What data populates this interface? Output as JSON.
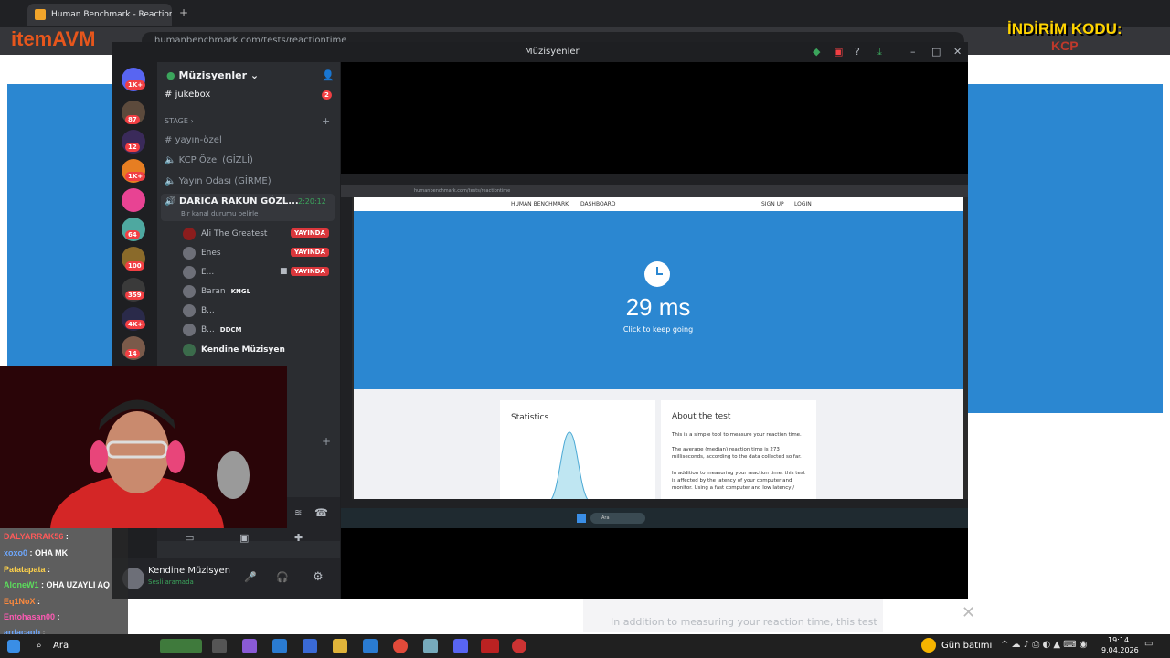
{
  "browser": {
    "tab_title": "Human Benchmark - Reaction Ti",
    "url": "humanbenchmark.com/tests/reactiontime"
  },
  "overlay": {
    "logo": "itemAVM",
    "promo": "İNDİRİM KODU:",
    "promo_code": "KCP"
  },
  "background_page": {
    "stats_text": "In addition to measuring your reaction time, this test"
  },
  "discord": {
    "window_title": "Müzisyenler",
    "server_name": "Müzisyenler",
    "guild_badges": [
      "1K+",
      "87",
      "12",
      "1K+",
      "",
      "64",
      "100",
      "359",
      "4K+",
      "14"
    ],
    "channels": [
      {
        "name": "jukebox",
        "badge": "2"
      },
      {
        "name": "STAGE"
      },
      {
        "name": "yayın-özel"
      },
      {
        "name": "KCP Özel (GİZLİ)"
      },
      {
        "name": "Yayın Odası (GİRME)"
      }
    ],
    "voice_channel": {
      "name": "DARICA RAKUN GÖZL...",
      "timer": "2:20:12",
      "status": "Bir kanal durumu belirle"
    },
    "members": [
      {
        "name": "Ali The Greatest",
        "live": "YAYINDA"
      },
      {
        "name": "Enes",
        "live": "YAYINDA"
      },
      {
        "name": "E...",
        "live": "YAYINDA"
      },
      {
        "name": "Baran",
        "tag": "KNGL"
      },
      {
        "name": "B..."
      },
      {
        "name": "B...",
        "tag": "DDCM"
      },
      {
        "name": "Kendine Müzisyen"
      }
    ],
    "user": {
      "name": "Kendine Müzisyen",
      "status": "Sesli aramada"
    }
  },
  "stream": {
    "url": "humanbenchmark.com/tests/reactiontime",
    "nav": {
      "brand": "HUMAN BENCHMARK",
      "dashboard": "DASHBOARD",
      "signup": "SIGN UP",
      "login": "LOGIN"
    },
    "result": "29 ms",
    "hint": "Click to keep going",
    "stats_title": "Statistics",
    "about_title": "About the test",
    "about_p1": "This is a simple tool to measure your reaction time.",
    "about_p2": "The average (median) reaction time is 273 milliseconds, according to the data collected so far.",
    "about_p3": "In addition to measuring your reaction time, this test is affected by the latency of your computer and monitor. Using a fast computer and low latency /",
    "taskbar_search": "Ara"
  },
  "chat": [
    {
      "user": "DALYARRAK56",
      "msg": "",
      "color": "#ff5a5a"
    },
    {
      "user": "xoxo0",
      "msg": "OHA MK",
      "color": "#6ea8ff"
    },
    {
      "user": "Patatapata",
      "msg": "",
      "color": "#ffd24a"
    },
    {
      "user": "AloneW1",
      "msg": "OHA UZAYLI AQ",
      "color": "#5cdc5c"
    },
    {
      "user": "Eq1NoX",
      "msg": "",
      "color": "#ff8a3d"
    },
    {
      "user": "Entohasan00",
      "msg": "",
      "color": "#ff5ab4"
    },
    {
      "user": "ardacagb",
      "msg": "",
      "color": "#6ea8ff"
    }
  ],
  "taskbar": {
    "search": "Ara",
    "weather": "Gün batımı",
    "time": "19:14",
    "date": "9.04.2026"
  }
}
